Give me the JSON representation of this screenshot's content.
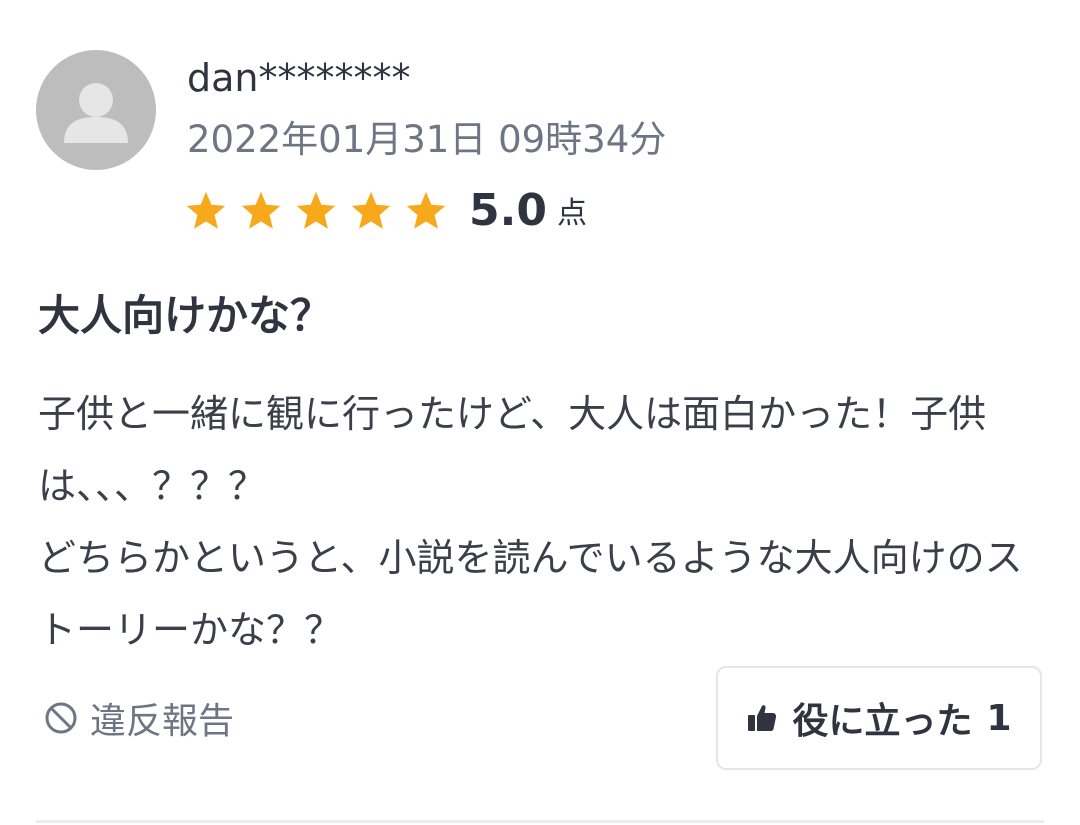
{
  "review": {
    "username": "dan********",
    "date": "2022年01月31日 09時34分",
    "rating": {
      "stars": 5,
      "max_stars": 5,
      "value": "5.0",
      "unit": "点",
      "star_color": "#f7a81b"
    },
    "title": "大人向けかな？",
    "body_lines": [
      "子供と一緒に観に行ったけど、大人は面白かった！子供は、、、？？？",
      "どちらかというと、小説を読んでいるような大人向けのストーリーかな？？"
    ]
  },
  "actions": {
    "report_label": "違反報告",
    "report_icon": "prohibited-icon",
    "helpful_label": "役に立った",
    "helpful_count": "1",
    "helpful_icon": "thumbs-up-icon"
  },
  "icons": {
    "avatar": "user-placeholder-icon"
  }
}
